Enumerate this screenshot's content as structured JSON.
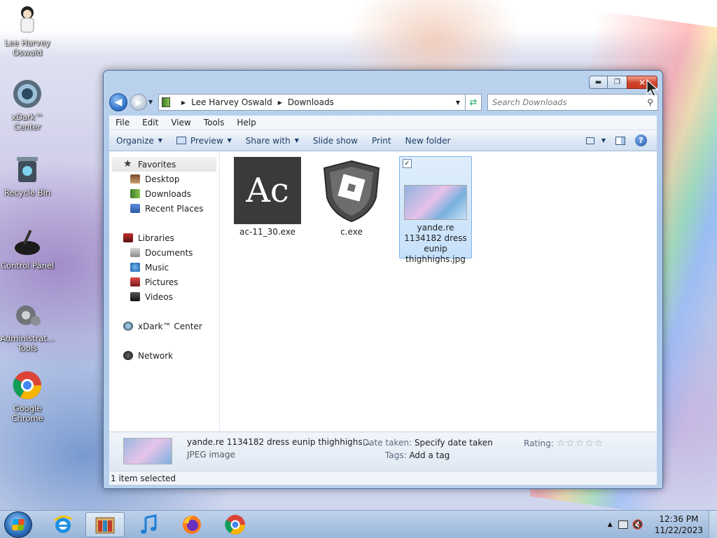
{
  "desktop": {
    "icons": [
      {
        "label": "Lee Harvey Oswald",
        "icon": "user-folder-icon"
      },
      {
        "label": "xDark™ Center",
        "icon": "xdark-center-icon"
      },
      {
        "label": "Recycle Bin",
        "icon": "recycle-bin-icon"
      },
      {
        "label": "Control Panel",
        "icon": "control-panel-icon"
      },
      {
        "label": "Administrat... Tools",
        "icon": "administrative-tools-icon"
      },
      {
        "label": "Google Chrome",
        "icon": "chrome-icon"
      }
    ]
  },
  "explorer": {
    "breadcrumb": [
      "Lee Harvey Oswald",
      "Downloads"
    ],
    "search_placeholder": "Search Downloads",
    "menu": [
      "File",
      "Edit",
      "View",
      "Tools",
      "Help"
    ],
    "toolbar": {
      "organize": "Organize",
      "preview": "Preview",
      "share_with": "Share with",
      "slide_show": "Slide show",
      "print": "Print",
      "new_folder": "New folder"
    },
    "nav": {
      "favorites": "Favorites",
      "favorites_items": [
        "Desktop",
        "Downloads",
        "Recent Places"
      ],
      "libraries": "Libraries",
      "libraries_items": [
        "Documents",
        "Music",
        "Pictures",
        "Videos"
      ],
      "xdark": "xDark™ Center",
      "network": "Network"
    },
    "files": [
      {
        "name": "ac-11_30.exe",
        "icon": "ac-app-icon",
        "selected": false
      },
      {
        "name": "c.exe",
        "icon": "roblox-shield-icon",
        "selected": false
      },
      {
        "name": "yande.re 1134182 dress eunip thighhighs.jpg",
        "icon": "image-thumbnail",
        "selected": true
      }
    ],
    "details": {
      "name": "yande.re 1134182 dress eunip thighhighs...",
      "type": "JPEG image",
      "date_taken_label": "Date taken:",
      "date_taken_value": "Specify date taken",
      "tags_label": "Tags:",
      "tags_value": "Add a tag",
      "rating_label": "Rating:",
      "rating_value": 0,
      "rating_max": 5
    },
    "status": "1 item selected"
  },
  "taskbar": {
    "apps": [
      "internet-explorer-icon",
      "windows-explorer-icon",
      "itunes-icon",
      "firefox-icon",
      "chrome-icon"
    ],
    "clock_time": "12:36 PM",
    "clock_date": "11/22/2023"
  },
  "colors": {
    "selection": "#c7e0fa",
    "close_button": "#d0432a",
    "window_frame": "#a9c5e8"
  }
}
